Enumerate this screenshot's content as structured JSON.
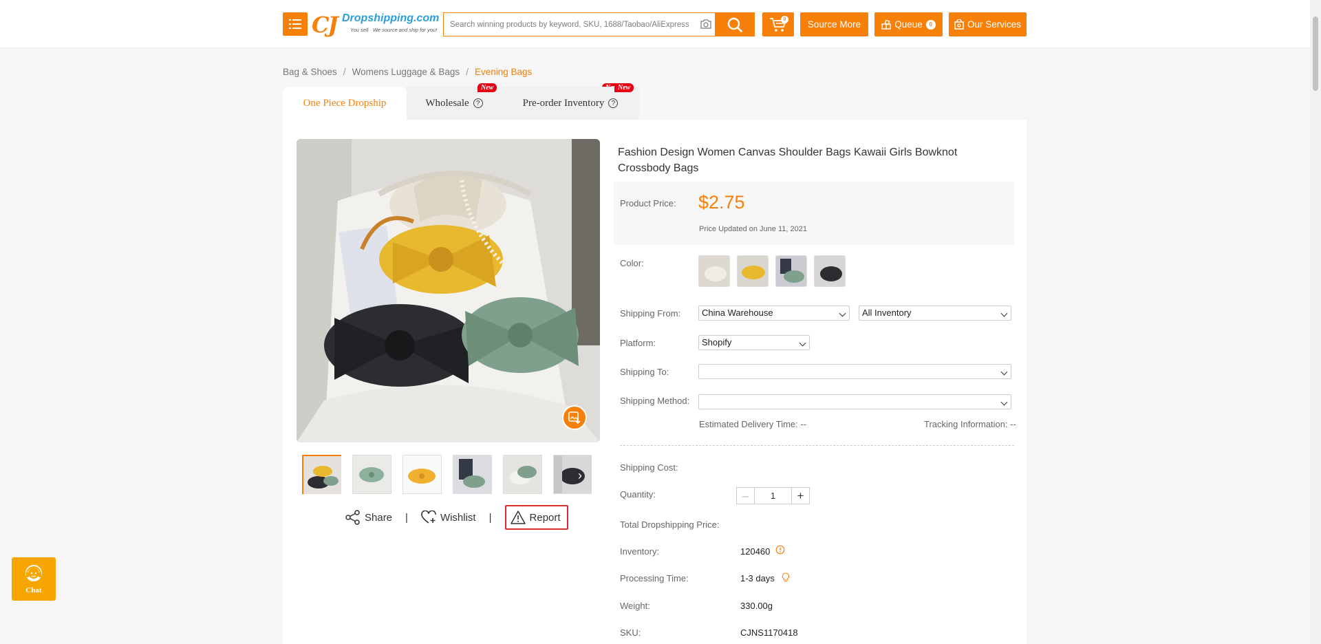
{
  "header": {
    "logo_cj": "CJ",
    "logo_brand": "Dropshipping.com",
    "logo_tagline": "You sell · We source and ship for you!",
    "search_placeholder": "Search winning products by keyword, SKU, 1688/Taobao/AliExpress URL",
    "cart_count": "0",
    "source_more": "Source More",
    "queue": "Queue",
    "queue_count": "0",
    "our_services": "Our Services"
  },
  "breadcrumb": [
    "Bag & Shoes",
    "Womens Luggage & Bags",
    "Evening Bags"
  ],
  "breadcrumb_sep": "/",
  "tabs": [
    {
      "label": "One Piece Dropship"
    },
    {
      "label": "Wholesale",
      "badge": "New"
    },
    {
      "label": "Pre-order Inventory",
      "badge": "New"
    }
  ],
  "product": {
    "title": "Fashion Design Women Canvas Shoulder Bags Kawaii Girls Bowknot Crossbody Bags",
    "price_label": "Product Price:",
    "price": "$2.75",
    "price_updated": "Price Updated on June 11, 2021",
    "color_label": "Color:",
    "shipping_from_label": "Shipping From:",
    "shipping_from": "China Warehouse",
    "inventory_filter": "All Inventory",
    "platform_label": "Platform:",
    "platform": "Shopify",
    "shipping_to_label": "Shipping To:",
    "shipping_to": "",
    "shipping_method_label": "Shipping Method:",
    "shipping_method": "",
    "est_delivery": "Estimated Delivery Time: --",
    "tracking_info": "Tracking Information: --",
    "shipping_cost_label": "Shipping Cost:",
    "quantity_label": "Quantity:",
    "quantity": "1",
    "qty_minus": "–",
    "qty_plus": "+",
    "total_label": "Total Dropshipping Price:",
    "inventory_label": "Inventory:",
    "inventory": "120460",
    "processing_label": "Processing Time:",
    "processing": "1-3 days",
    "weight_label": "Weight:",
    "weight": "330.00g",
    "sku_label": "SKU:",
    "sku": "CJNS1170418"
  },
  "actions": {
    "share": "Share",
    "wishlist": "Wishlist",
    "report": "Report",
    "sep": "|"
  },
  "chat": {
    "label": "Chat"
  },
  "colors": {
    "accent": "#f7800a",
    "badge_red": "#e60012",
    "report_border": "#d62c2c"
  }
}
